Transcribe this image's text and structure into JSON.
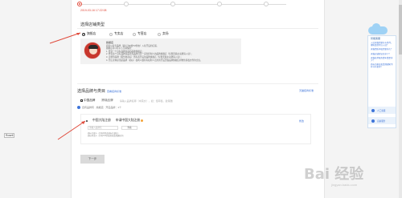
{
  "steps": {
    "count": 5,
    "active_index": 0,
    "date": "2019-03-16 17:22:08"
  },
  "store_type": {
    "title": "选择店铺类型",
    "options": [
      {
        "label": "旗舰店",
        "checked": true
      },
      {
        "label": "专卖店",
        "checked": false
      },
      {
        "label": "专营店",
        "checked": false
      },
      {
        "label": "卖场",
        "checked": false
      }
    ]
  },
  "info_panel": {
    "name": "旗舰店",
    "lines": [
      "商家以自有品牌（商标为R或TM状态）入驻开设的店铺。",
      "旗舰店可以有以下几种情形：",
      "1. 经营一个自有品牌商品的品牌旗舰店；",
      "2. 经营多个自有品牌商品且各品牌归同一实际控制人的品牌旗舰店（仅限天猫主动邀请入驻）；",
      "3. 卖场型品牌（服务类商标）所有者开设的品牌旗舰店（仅限天猫主动邀请入驻）；",
      "4. 开店主体必须是品牌（商标）权利人或持有权利人出具的开设天猫品牌旗舰店排他性授权文件的企业。"
    ]
  },
  "brand": {
    "title": "选择品牌与类目",
    "title_link": "查看招商标准",
    "right_link": "天猫招商标准",
    "tabs": [
      {
        "label": "中国品牌",
        "active": true
      },
      {
        "label": "跨境品牌",
        "active": false
      }
    ],
    "search_hint": "请输入品牌名称（中英文），如：佰草集、欧莱雅",
    "note": "自有品牌有 · 旗舰店 · 开店品牌：1个",
    "card": {
      "title_left": "中国大陆注册",
      "title_right": "申请中国大陆注册",
      "edit": "修改",
      "field_placeholder": "请输入品牌名",
      "field_button": "查看",
      "desc_lines": [
        "商标注册人（持有R状态商标注册证）",
        "商标申请人（持有TM状态商标受理通知书）"
      ]
    }
  },
  "next_button": "下一步",
  "side_label": "Rosell",
  "service_panel": {
    "header": "智能客服",
    "questions": [
      "入驻天猫需要什么条件，哪些类目可以入驻？",
      "天猫资质审核需要多久？",
      "天猫店铺保证金多少？",
      "天猫技术服务费年费是多少？",
      "商标注册证和受理通知书有什么要求？"
    ],
    "actions": [
      "人工客服",
      "自助服务"
    ]
  },
  "watermark": {
    "text": "Bai 经验",
    "sub": "jingyan.baidu.com"
  },
  "colors": {
    "accent": "#e04a3b",
    "link": "#3e74d9",
    "panel_border": "#cfe0f2"
  }
}
